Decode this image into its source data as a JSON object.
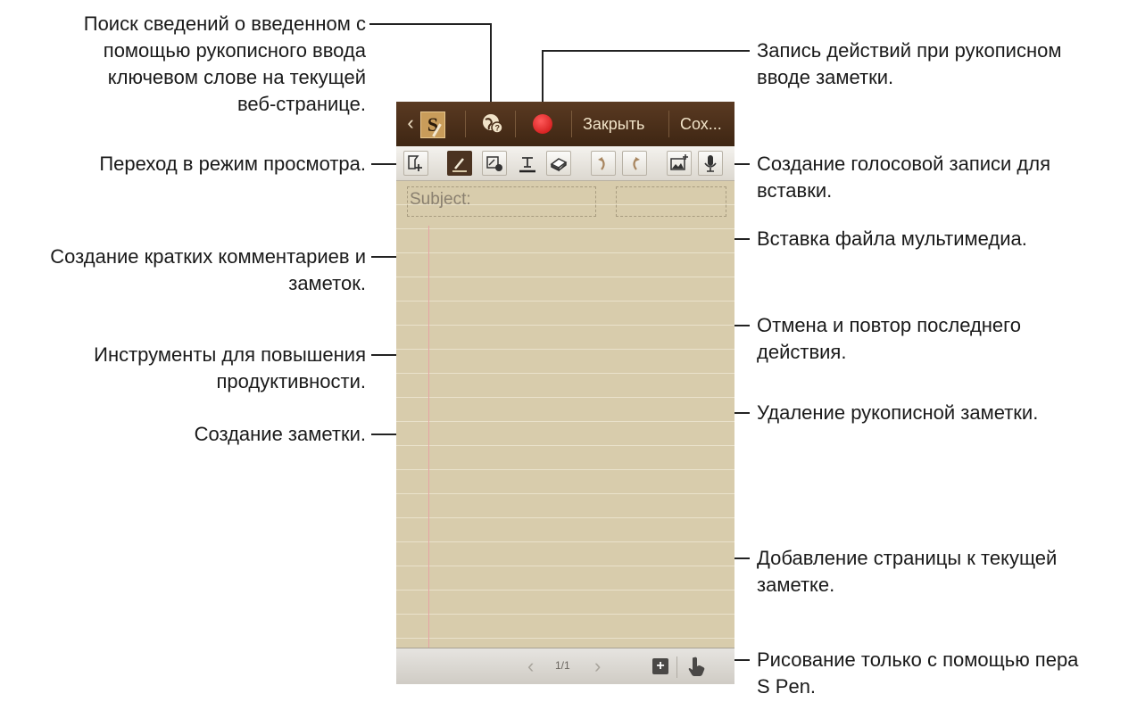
{
  "annotations": {
    "search": "Поиск сведений о введенном с\nпомощью рукописного ввода\nключевом слове на текущей\nвеб-странице.",
    "view_mode": "Переход в режим просмотра.",
    "quick_notes": "Создание кратких комментариев и\nзаметок.",
    "productivity": "Инструменты для повышения\nпродуктивности.",
    "create_note": "Создание заметки.",
    "record": "Запись действий при рукописном\nвводе заметки.",
    "voice": "Создание голосовой записи для\nвставки.",
    "media": "Вставка файла мультимедиа.",
    "undo_redo": "Отмена и повтор последнего\nдействия.",
    "erase": "Удаление рукописной заметки.",
    "add_page": "Добавление страницы к текущей\nзаметке.",
    "pen_only": "Рисование только с помощью пера\nS Pen."
  },
  "app": {
    "back_icon": "‹",
    "logo_letter": "S",
    "close_label": "Закрыть",
    "save_label": "Сох...",
    "subject_placeholder": "Subject:",
    "page_indicator": "1/1",
    "prev_icon": "‹",
    "next_icon": "›",
    "add_page_icon": "+"
  },
  "colors": {
    "topbar": "#4a2e19",
    "paper": "#d8ccac",
    "record": "#e01818",
    "callout_line": "#222222"
  },
  "icons": [
    "back-icon",
    "s-note-icon",
    "search-web-icon",
    "record-icon",
    "view-mode-icon",
    "pen-icon",
    "shapes-icon",
    "text-icon",
    "eraser-icon",
    "undo-icon",
    "redo-icon",
    "insert-image-icon",
    "microphone-icon",
    "add-page-icon",
    "hand-icon"
  ]
}
